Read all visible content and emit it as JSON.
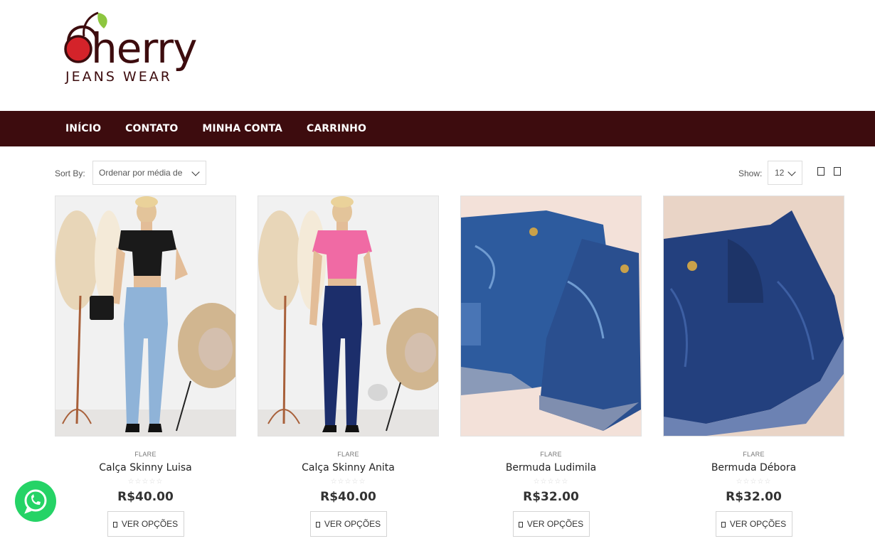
{
  "brand": {
    "logo_word": "herry",
    "logo_sub": "JEANS WEAR",
    "colors": {
      "wine": "#3d0c0e",
      "cherry_red": "#d4232a",
      "leaf_green": "#8dc63f",
      "whatsapp": "#25d366"
    }
  },
  "nav": {
    "items": [
      "INÍCIO",
      "CONTATO",
      "MINHA CONTA",
      "CARRINHO"
    ]
  },
  "toolbar": {
    "sort_label": "Sort By:",
    "sort_value": "Ordenar por média de",
    "show_label": "Show:",
    "show_value": "12",
    "view_icons": [
      "grid-view-icon",
      "list-view-icon"
    ]
  },
  "products": [
    {
      "category": "FLARE",
      "name": "Calça Skinny Luisa",
      "price": "R$40.00",
      "rating_stars": "☆☆☆☆☆",
      "button": "VER OPÇÕES"
    },
    {
      "category": "FLARE",
      "name": "Calça Skinny Anita",
      "price": "R$40.00",
      "rating_stars": "☆☆☆☆☆",
      "button": "VER OPÇÕES"
    },
    {
      "category": "FLARE",
      "name": "Bermuda Ludimila",
      "price": "R$32.00",
      "rating_stars": "☆☆☆☆☆",
      "button": "VER OPÇÕES"
    },
    {
      "category": "FLARE",
      "name": "Bermuda Débora",
      "price": "R$32.00",
      "rating_stars": "☆☆☆☆☆",
      "button": "VER OPÇÕES"
    }
  ],
  "floating": {
    "icon": "whatsapp-icon"
  }
}
